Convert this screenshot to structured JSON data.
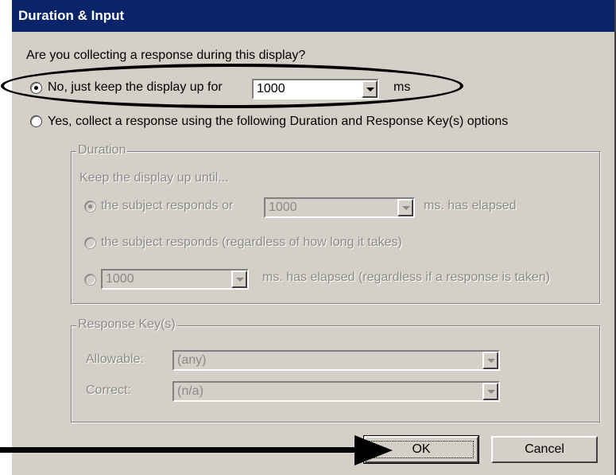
{
  "window": {
    "title": "Duration & Input"
  },
  "question": "Are you collecting a response during this display?",
  "option_no": {
    "label": "No, just keep the display up for",
    "value": "1000",
    "unit": "ms",
    "selected": true
  },
  "option_yes": {
    "label": "Yes, collect a response using the following Duration and Response Key(s) options",
    "selected": false
  },
  "duration_group": {
    "title": "Duration",
    "subtitle": "Keep the display up until...",
    "opt1": {
      "label": "the subject responds or",
      "value": "1000",
      "suffix": "ms. has elapsed"
    },
    "opt2": {
      "label": "the subject responds (regardless of how long it takes)"
    },
    "opt3": {
      "value": "1000",
      "suffix": "ms. has elapsed (regardless if a response is taken)"
    }
  },
  "response_group": {
    "title": "Response Key(s)",
    "allowable_label": "Allowable:",
    "allowable_value": "(any)",
    "correct_label": "Correct:",
    "correct_value": "(n/a)"
  },
  "buttons": {
    "ok": "OK",
    "cancel": "Cancel"
  }
}
